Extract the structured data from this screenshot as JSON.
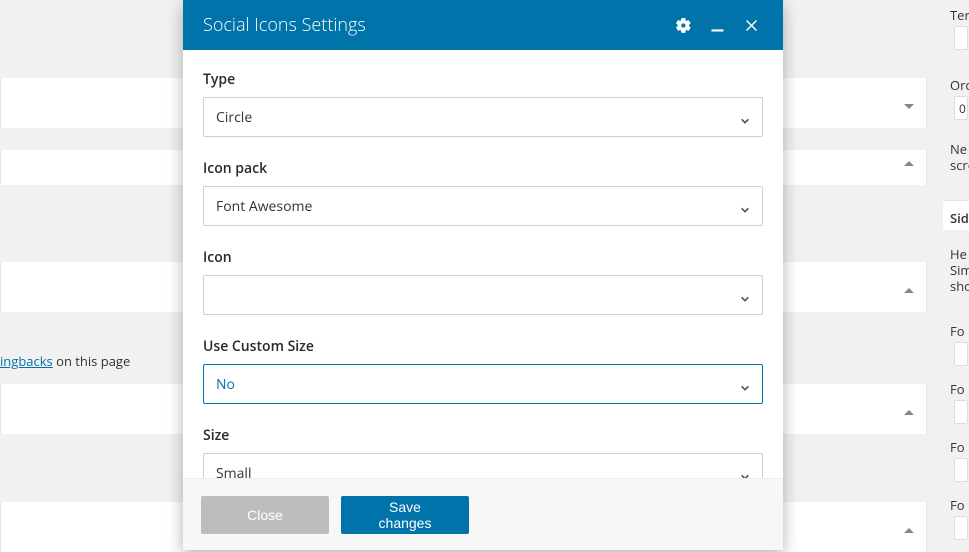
{
  "modal": {
    "title": "Social Icons Settings",
    "fields": {
      "type": {
        "label": "Type",
        "value": "Circle"
      },
      "icon_pack": {
        "label": "Icon pack",
        "value": "Font Awesome"
      },
      "icon": {
        "label": "Icon",
        "value": ""
      },
      "use_custom_size": {
        "label": "Use Custom Size",
        "value": "No"
      },
      "size": {
        "label": "Size",
        "value": "Small"
      }
    },
    "buttons": {
      "close": "Close",
      "save": "Save changes"
    }
  },
  "background": {
    "pingbacks_link": "ingbacks",
    "pingbacks_text": " on this page",
    "side_labels": {
      "ter": "Ter",
      "order_value": "0",
      "nex": "Ne",
      "scr": "scre",
      "sid": "Sid",
      "hex": "He",
      "sim": "Sim",
      "sho": "sho",
      "fo1": "Fo",
      "fo2": "Fo",
      "fo3": "Fo",
      "fo4": "Fo"
    }
  }
}
